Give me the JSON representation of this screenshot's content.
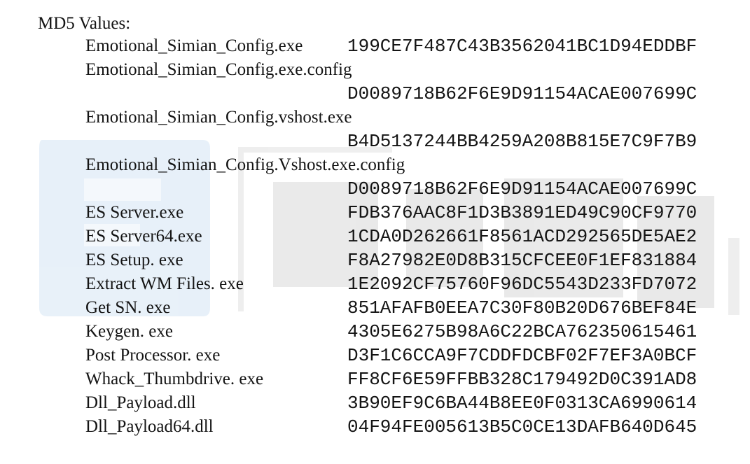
{
  "heading": "MD5 Values:",
  "entries": [
    {
      "file": "Emotional_Simian_Config.exe",
      "hash": "199CE7F487C43B3562041BC1D94EDDBF",
      "wrapped": false
    },
    {
      "file": "Emotional_Simian_Config.exe.config",
      "hash": "D0089718B62F6E9D91154ACAE007699C",
      "wrapped": true
    },
    {
      "file": "Emotional_Simian_Config.vshost.exe",
      "hash": "B4D5137244BB4259A208B815E7C9F7B9",
      "wrapped": true
    },
    {
      "file": "Emotional_Simian_Config.Vshost.exe.config",
      "hash": "D0089718B62F6E9D91154ACAE007699C",
      "wrapped": true
    },
    {
      "file": "ES Server.exe",
      "hash": "FDB376AAC8F1D3B3891ED49C90CF9770",
      "wrapped": false
    },
    {
      "file": "ES Server64.exe",
      "hash": "1CDA0D262661F8561ACD292565DE5AE2",
      "wrapped": false
    },
    {
      "file": "ES Setup. exe",
      "hash": "F8A27982E0D8B315CFCEE0F1EF831884",
      "wrapped": false
    },
    {
      "file": "Extract WM Files. exe",
      "hash": "1E2092CF75760F96DC5543D233FD7072",
      "wrapped": false
    },
    {
      "file": "Get SN. exe",
      "hash": "851AFAFB0EEA7C30F80B20D676BEF84E",
      "wrapped": false
    },
    {
      "file": "Keygen. exe",
      "hash": "4305E6275B98A6C22BCA762350615461",
      "wrapped": false
    },
    {
      "file": "Post Processor. exe",
      "hash": "D3F1C6CCA9F7CDDFDCBF02F7EF3A0BCF",
      "wrapped": false
    },
    {
      "file": "Whack_Thumbdrive. exe",
      "hash": "FF8CF6E59FFBB328C179492D0C391AD8",
      "wrapped": false
    },
    {
      "file": "Dll_Payload.dll",
      "hash": "3B90EF9C6BA44B8EE0F0313CA6990614",
      "wrapped": false
    },
    {
      "file": "Dll_Payload64.dll",
      "hash": "04F94FE005613B5C0CE13DAFB640D645",
      "wrapped": false
    }
  ]
}
